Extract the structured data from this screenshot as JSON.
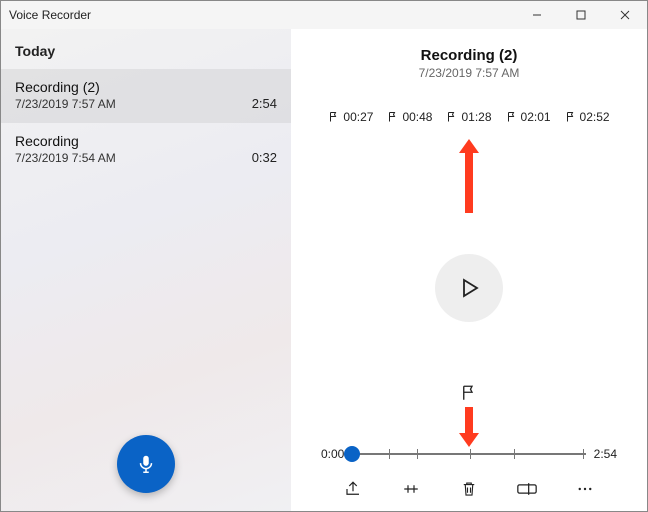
{
  "app_title": "Voice Recorder",
  "sidebar": {
    "section": "Today",
    "recordings": [
      {
        "title": "Recording (2)",
        "date": "7/23/2019 7:57 AM",
        "duration": "2:54",
        "selected": true
      },
      {
        "title": "Recording",
        "date": "7/23/2019 7:54 AM",
        "duration": "0:32",
        "selected": false
      }
    ]
  },
  "current": {
    "title": "Recording (2)",
    "datetime": "7/23/2019 7:57 AM",
    "markers": [
      "00:27",
      "00:48",
      "01:28",
      "02:01",
      "02:52"
    ],
    "position": "0:00",
    "total": "2:54"
  },
  "colors": {
    "accent": "#0a63c6",
    "annotation": "#ff3b1f"
  }
}
